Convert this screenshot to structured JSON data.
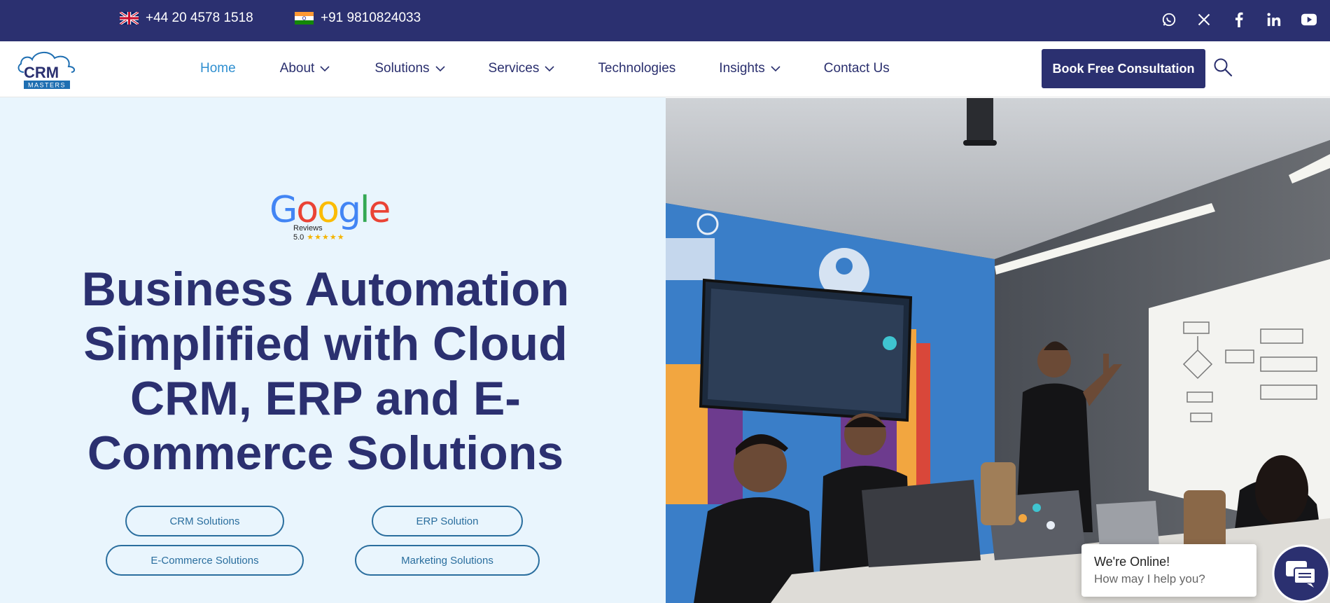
{
  "topbar": {
    "phone_uk": "+44 20 4578 1518",
    "phone_in": "+91 9810824033",
    "socials": [
      "whatsapp-icon",
      "x-icon",
      "facebook-icon",
      "linkedin-icon",
      "youtube-icon"
    ]
  },
  "logo": {
    "text": "CRM",
    "sub": "MASTERS"
  },
  "nav": {
    "items": [
      {
        "label": "Home",
        "active": true
      },
      {
        "label": "About",
        "dropdown": true
      },
      {
        "label": "Solutions",
        "dropdown": true
      },
      {
        "label": "Services",
        "dropdown": true
      },
      {
        "label": "Technologies"
      },
      {
        "label": "Insights",
        "dropdown": true
      },
      {
        "label": "Contact Us"
      }
    ],
    "cta": "Book Free Consultation"
  },
  "hero": {
    "google_letters": [
      "G",
      "o",
      "o",
      "g",
      "l",
      "e"
    ],
    "reviews_label": "Reviews",
    "rating": "5.0",
    "stars": "★★★★★",
    "headline": "Business Automation Simplified with Cloud CRM, ERP and E-Commerce Solutions",
    "buttons": [
      "CRM Solutions",
      "ERP Solution",
      "E-Commerce Solutions",
      "Marketing Solutions"
    ]
  },
  "chat": {
    "title": "We're Online!",
    "subtitle": "How may I help you?"
  },
  "colors": {
    "brand_navy": "#2b3070",
    "accent_blue": "#2f8fd0",
    "hero_bg": "#e9f5fd",
    "pill_border": "#2a6e9e"
  }
}
